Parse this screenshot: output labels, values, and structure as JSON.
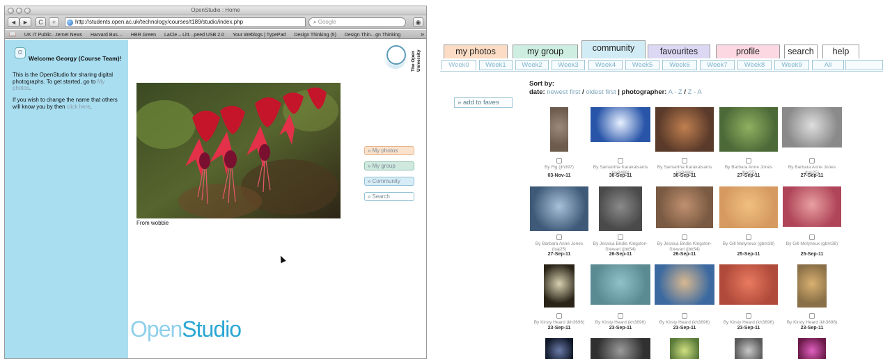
{
  "browser": {
    "window_title": "OpenStudio : Home",
    "url": "http://students.open.ac.uk/technology/courses/t189/studio/index.php",
    "search_placeholder": "Google",
    "nav": {
      "back": "◄",
      "forward": "►",
      "reload": "C",
      "add": "+"
    },
    "bookmarks": [
      "UK IT Public…ternet News",
      "Harvard Bus…",
      "HBR Green",
      "LaCie – Litt…peed USB 2.0",
      "Your Weblogs | TypePad",
      "Design Thinking (5)",
      "Design Thin…gn Thinking"
    ],
    "bookmarks_more": "»"
  },
  "openstudio": {
    "welcome": "Welcome Georgy (Course Team)!",
    "intro_text": "This is the OpenStudio for sharing digital photographs. To get started, go to",
    "intro_link": "My photos",
    "intro_end": ".",
    "change_name_text": "If you wish to change the name that others will know you by then",
    "change_name_link": "click here",
    "change_name_end": ".",
    "photo_caption": "From wobbie",
    "logo_text": "The Open University",
    "buttons": [
      {
        "label": "My photos",
        "color": "#fbe2cc",
        "border": "#e8b48c"
      },
      {
        "label": "My group",
        "color": "#cfe9de",
        "border": "#8fbfab"
      },
      {
        "label": "Community",
        "color": "#d6ecf6",
        "border": "#8fbfd6"
      },
      {
        "label": "Search",
        "color": "#ffffff",
        "border": "#8fbfd6"
      }
    ],
    "brand_light": "Open",
    "brand_bold": "Studio"
  },
  "community": {
    "tabs": [
      {
        "label": "my photos",
        "color": "#fcdcc4"
      },
      {
        "label": "my group",
        "color": "#cdeee1"
      },
      {
        "label": "community",
        "color": "#d2ecf6"
      },
      {
        "label": "favourites",
        "color": "#dcd8f4"
      },
      {
        "label": "profile",
        "color": "#fcd8e2"
      },
      {
        "label": "search",
        "color": "#ffffff"
      },
      {
        "label": "help",
        "color": "#ffffff"
      }
    ],
    "weeks": [
      "Week0",
      "Week1",
      "Week2",
      "Week3",
      "Week4",
      "Week5",
      "Week6",
      "Week7",
      "Week8",
      "Week9",
      "All"
    ],
    "sort_label": "Sort by:",
    "sort_date_label": "date:",
    "sort_newest": "newest first",
    "sort_slash1": "/",
    "sort_oldest": "oldest first",
    "sort_sep": "|",
    "sort_photographer_label": "photographer:",
    "sort_az": "A - Z",
    "sort_slash2": "/",
    "sort_za": "Z - A",
    "faves_button": "add to faves",
    "photos": [
      {
        "by": "By Fig (jlh397)",
        "date": "03-Nov-11"
      },
      {
        "by": "By Samantha Karakatsanis (sk8488)",
        "date": "30-Sep-11"
      },
      {
        "by": "By Samantha Karakatsanis (sk8488)",
        "date": "30-Sep-11"
      },
      {
        "by": "By Barbara Anne Jones (baj25)",
        "date": "27-Sep-11"
      },
      {
        "by": "By Barbara Anne Jones (baj25)",
        "date": "27-Sep-11"
      },
      {
        "by": "By Barbara Anne Jones (baj25)",
        "date": "27-Sep-11"
      },
      {
        "by": "By Jessica Bridie Kingston-Stewart (jbk54)",
        "date": "26-Sep-11"
      },
      {
        "by": "By Jessica Bridie Kingston-Stewart (jbk54)",
        "date": "26-Sep-11"
      },
      {
        "by": "By Gill Molyneux (gbm38)",
        "date": "25-Sep-11"
      },
      {
        "by": "By Gill Molyneux (gbm38)",
        "date": "25-Sep-11"
      },
      {
        "by": "By Kirsty Heard (kh3696)",
        "date": "23-Sep-11"
      },
      {
        "by": "By Kirsty Heard (kh3696)",
        "date": "23-Sep-11"
      },
      {
        "by": "By Kirsty Heard (kh3696)",
        "date": "23-Sep-11"
      },
      {
        "by": "By Kirsty Heard (kh3696)",
        "date": "23-Sep-11"
      },
      {
        "by": "By Kirsty Heard (kh3696)",
        "date": "23-Sep-11"
      }
    ]
  }
}
